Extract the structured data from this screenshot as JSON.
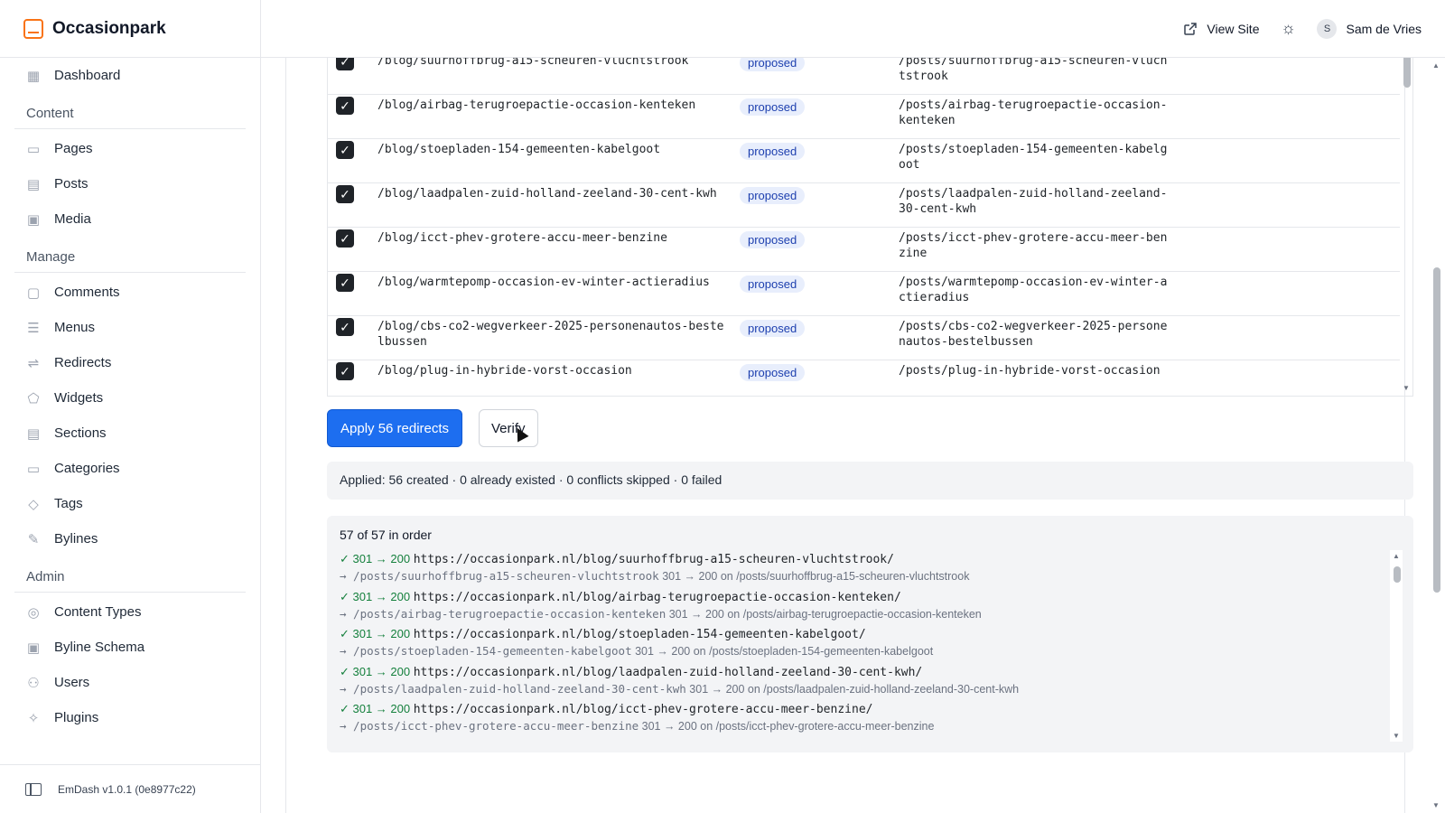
{
  "brand": {
    "name": "Occasionpark",
    "accent": "#f97316"
  },
  "sidebar": {
    "items": [
      {
        "type": "item",
        "label": "Dashboard",
        "icon": "dashboard-icon",
        "glyph": "▦"
      },
      {
        "type": "section",
        "label": "Content"
      },
      {
        "type": "item",
        "label": "Pages",
        "icon": "pages-icon",
        "glyph": "▭"
      },
      {
        "type": "item",
        "label": "Posts",
        "icon": "posts-icon",
        "glyph": "▤"
      },
      {
        "type": "item",
        "label": "Media",
        "icon": "media-icon",
        "glyph": "▣"
      },
      {
        "type": "section",
        "label": "Manage"
      },
      {
        "type": "item",
        "label": "Comments",
        "icon": "comments-icon",
        "glyph": "▢"
      },
      {
        "type": "item",
        "label": "Menus",
        "icon": "menus-icon",
        "glyph": "☰"
      },
      {
        "type": "item",
        "label": "Redirects",
        "icon": "redirects-icon",
        "glyph": "⇌"
      },
      {
        "type": "item",
        "label": "Widgets",
        "icon": "widgets-icon",
        "glyph": "⬠"
      },
      {
        "type": "item",
        "label": "Sections",
        "icon": "sections-icon",
        "glyph": "▤"
      },
      {
        "type": "item",
        "label": "Categories",
        "icon": "categories-icon",
        "glyph": "▭"
      },
      {
        "type": "item",
        "label": "Tags",
        "icon": "tag-icon",
        "glyph": "◇"
      },
      {
        "type": "item",
        "label": "Bylines",
        "icon": "bylines-icon",
        "glyph": "✎"
      },
      {
        "type": "section",
        "label": "Admin"
      },
      {
        "type": "item",
        "label": "Content Types",
        "icon": "database-icon",
        "glyph": "◎"
      },
      {
        "type": "item",
        "label": "Byline Schema",
        "icon": "schema-icon",
        "glyph": "▣"
      },
      {
        "type": "item",
        "label": "Users",
        "icon": "users-icon",
        "glyph": "⚇"
      },
      {
        "type": "item",
        "label": "Plugins",
        "icon": "plugins-icon",
        "glyph": "✧"
      }
    ],
    "footer": "EmDash v1.0.1 (0e8977c22)"
  },
  "topbar": {
    "view_site": "View Site",
    "user_initial": "S",
    "user_name": "Sam de Vries"
  },
  "redirects_table": {
    "status_badge_color": "#e8eefc",
    "rows": [
      {
        "checked": true,
        "source": "/blog/suurhoffbrug-a15-scheuren-vluchtstrook",
        "status": "proposed",
        "target": "/posts/suurhoffbrug-a15-scheuren-vluchtstrook"
      },
      {
        "checked": true,
        "source": "/blog/airbag-terugroepactie-occasion-kenteken",
        "status": "proposed",
        "target": "/posts/airbag-terugroepactie-occasion-kenteken"
      },
      {
        "checked": true,
        "source": "/blog/stoepladen-154-gemeenten-kabelgoot",
        "status": "proposed",
        "target": "/posts/stoepladen-154-gemeenten-kabelgoot"
      },
      {
        "checked": true,
        "source": "/blog/laadpalen-zuid-holland-zeeland-30-cent-kwh",
        "status": "proposed",
        "target": "/posts/laadpalen-zuid-holland-zeeland-30-cent-kwh"
      },
      {
        "checked": true,
        "source": "/blog/icct-phev-grotere-accu-meer-benzine",
        "status": "proposed",
        "target": "/posts/icct-phev-grotere-accu-meer-benzine"
      },
      {
        "checked": true,
        "source": "/blog/warmtepomp-occasion-ev-winter-actieradius",
        "status": "proposed",
        "target": "/posts/warmtepomp-occasion-ev-winter-actieradius"
      },
      {
        "checked": true,
        "source": "/blog/cbs-co2-wegverkeer-2025-personenautos-bestelbussen",
        "status": "proposed",
        "target": "/posts/cbs-co2-wegverkeer-2025-personenautos-bestelbussen"
      },
      {
        "checked": true,
        "source": "/blog/plug-in-hybride-vorst-occasion",
        "status": "proposed",
        "target": "/posts/plug-in-hybride-vorst-occasion"
      }
    ]
  },
  "actions": {
    "apply_label": "Apply 56 redirects",
    "verify_label": "Verify",
    "primary_color": "#1d6ef0"
  },
  "apply_summary": "Applied: 56 created · 0 already existed · 0 conflicts skipped · 0 failed",
  "verify_results": {
    "heading": "57 of 57 in order",
    "ok_color": "#15803d",
    "items": [
      {
        "status": "✓ 301 → 200",
        "url": "https://occasionpark.nl/blog/suurhoffbrug-a15-scheuren-vluchtstrook/",
        "target_path": "→ /posts/suurhoffbrug-a15-scheuren-vluchtstrook",
        "result": "301 → 200 on /posts/suurhoffbrug-a15-scheuren-vluchtstrook"
      },
      {
        "status": "✓ 301 → 200",
        "url": "https://occasionpark.nl/blog/airbag-terugroepactie-occasion-kenteken/",
        "target_path": "→ /posts/airbag-terugroepactie-occasion-kenteken",
        "result": "301 → 200 on /posts/airbag-terugroepactie-occasion-kenteken"
      },
      {
        "status": "✓ 301 → 200",
        "url": "https://occasionpark.nl/blog/stoepladen-154-gemeenten-kabelgoot/",
        "target_path": "→ /posts/stoepladen-154-gemeenten-kabelgoot",
        "result": "301 → 200 on /posts/stoepladen-154-gemeenten-kabelgoot"
      },
      {
        "status": "✓ 301 → 200",
        "url": "https://occasionpark.nl/blog/laadpalen-zuid-holland-zeeland-30-cent-kwh/",
        "target_path": "→ /posts/laadpalen-zuid-holland-zeeland-30-cent-kwh",
        "result": "301 → 200 on /posts/laadpalen-zuid-holland-zeeland-30-cent-kwh"
      },
      {
        "status": "✓ 301 → 200",
        "url": "https://occasionpark.nl/blog/icct-phev-grotere-accu-meer-benzine/",
        "target_path": "→ /posts/icct-phev-grotere-accu-meer-benzine",
        "result": "301 → 200 on /posts/icct-phev-grotere-accu-meer-benzine"
      }
    ]
  }
}
